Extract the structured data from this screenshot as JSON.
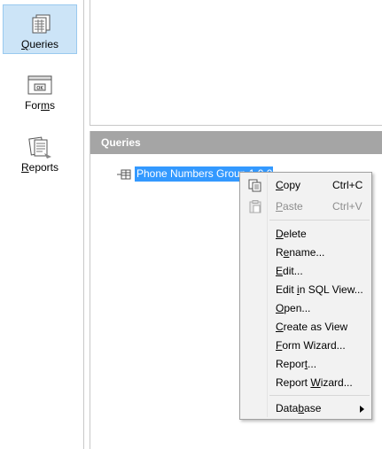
{
  "sidebar": {
    "items": [
      {
        "label": "Queries",
        "mnemonic_index": 0,
        "icon": "queries-icon",
        "selected": true
      },
      {
        "label": "Forms",
        "mnemonic_index": 3,
        "icon": "forms-icon",
        "selected": false
      },
      {
        "label": "Reports",
        "mnemonic_index": 0,
        "icon": "reports-icon",
        "selected": false
      }
    ],
    "forms_icon_text": "OK"
  },
  "queries_pane": {
    "header": "Queries",
    "selected_query": "Phone Numbers Group 1.0.0"
  },
  "context_menu": {
    "copy": {
      "label": "Copy",
      "shortcut": "Ctrl+C"
    },
    "paste": {
      "label": "Paste",
      "shortcut": "Ctrl+V",
      "disabled": true
    },
    "delete": "Delete",
    "rename": "Rename...",
    "edit": "Edit...",
    "edit_sql": "Edit in SQL View...",
    "open": "Open...",
    "create_view": "Create as View",
    "form_wizard": "Form Wizard...",
    "report": "Report...",
    "report_wizard": "Report Wizard...",
    "database": "Database"
  },
  "colors": {
    "selection": "#3399ff",
    "sidebar_selected": "#cce4f7",
    "header_bg": "#a5a5a5",
    "menu_bg": "#f2f2f2"
  }
}
